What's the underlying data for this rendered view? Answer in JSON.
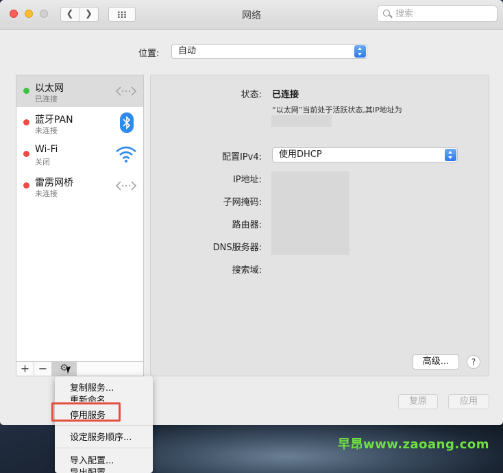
{
  "window": {
    "title": "网络"
  },
  "search": {
    "placeholder": "搜索"
  },
  "location": {
    "label": "位置:",
    "value": "自动"
  },
  "services": [
    {
      "name": "以太网",
      "status": "已连接",
      "dot": "green",
      "icon": "ethernet-icon",
      "selected": true
    },
    {
      "name": "蓝牙PAN",
      "status": "未连接",
      "dot": "red",
      "icon": "bluetooth-icon"
    },
    {
      "name": "Wi-Fi",
      "status": "关闭",
      "dot": "red",
      "icon": "wifi-icon"
    },
    {
      "name": "雷雳网桥",
      "status": "未连接",
      "dot": "red",
      "icon": "ethernet-icon"
    }
  ],
  "sidebar_bar": {
    "plus": "+",
    "minus": "−",
    "gear": "⚙"
  },
  "detail": {
    "status_label": "状态:",
    "status_value": "已连接",
    "status_desc": "“以太网”当前处于活跃状态,其IP地址为",
    "ipv4_label": "配置IPv4:",
    "ipv4_value": "使用DHCP",
    "ip_label": "IP地址:",
    "subnet_label": "子网掩码:",
    "router_label": "路由器:",
    "dns_label": "DNS服务器:",
    "search_domain_label": "搜索域:"
  },
  "buttons": {
    "advanced": "高级...",
    "help": "?",
    "revert": "复原",
    "apply": "应用"
  },
  "menu": {
    "items": [
      "复制服务...",
      "重新命名...",
      "停用服务",
      "设定服务顺序...",
      "导入配置...",
      "导出配置..."
    ],
    "highlighted": "停用服务"
  },
  "watermark": "早昂www.zaoang.com",
  "colors": {
    "accent": "#2f77ee",
    "connected": "#3ec243",
    "disconnected": "#ee4a47",
    "highlight_border": "#e4503f"
  }
}
